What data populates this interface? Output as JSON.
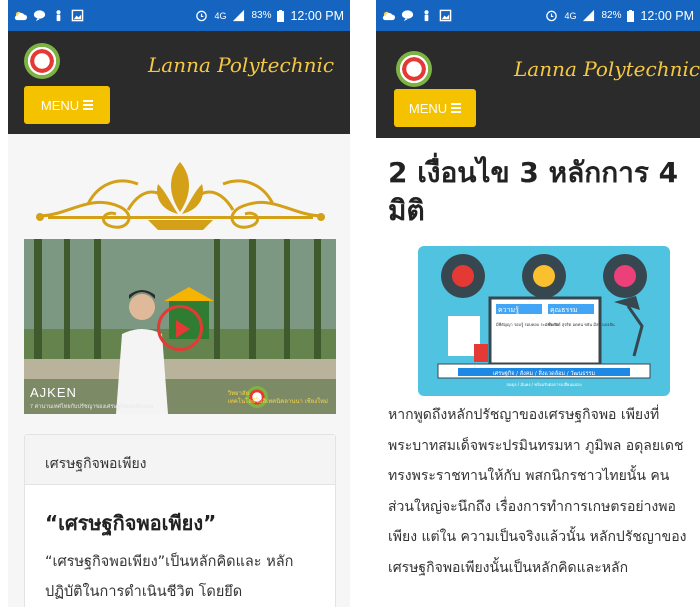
{
  "left_phone": {
    "status": {
      "battery": "83%",
      "time": "12:00 PM",
      "network": "4G"
    },
    "brand": "Lanna Polytechnic",
    "menu_label": "MENU",
    "video": {
      "watermark": "AJKEN",
      "caption": "7 ค่านานเทศไทยกับปรัชญาของเศรษฐกิจพอเพียงคณ",
      "badge_text": "วิทยาลัย\nเทคโนโลยีโปลิเทคนิคลานนา เชียงใหม่"
    },
    "card": {
      "heading": "เศรษฐกิจพอเพียง",
      "title": "“เศรษฐกิจพอเพียง”",
      "text": "“เศรษฐกิจพอเพียง”เป็นหลักคิดและ หลักปฏิบัติในการดำเนินชีวิต โดยยึด"
    }
  },
  "right_phone": {
    "status": {
      "battery": "82%",
      "time": "12:00 PM",
      "network": "4G"
    },
    "brand": "Lanna Polytechnic",
    "menu_label": "MENU",
    "title": "2 เงื่อนไข 3 หลักการ 4 มิติ",
    "illustration": {
      "panel_left_title": "ความรู้",
      "panel_right_title": "คุณธรรม",
      "panel_left_text": "มีพียัญญา รอบรู้ รอบคอบ ระมัดระวัง",
      "panel_right_text": "ซื่อสัตย์ สุจริต อดทน ขยัน มีสติ แบ่งปัน",
      "banner": "เศรษฐกิจ / สังคม / สิ่งแวดล้อม / วัฒนธรรม",
      "banner_sub": "สมดุล / มั่นคง / พร้อมรับต่อการเปลี่ยนแปลง"
    },
    "body": "หากพูดถึงหลักปรัชญาของเศรษฐกิจพอ เพียงที่พระบาทสมเด็จพระปรมินทรมหา ภูมิพล อดุลยเดช ทรงพระราชทานให้กับ พสกนิกรชาวไทยนั้น คนส่วนใหญ่จะนึกถึง เรื่องการทำการเกษตรอย่างพอเพียง แต่ใน ความเป็นจริงแล้วนั้น หลักปรัชญาของ เศรษฐกิจพอเพียงนั้นเป็นหลักคิดและหลัก"
  },
  "colors": {
    "status_bar": "#1565c0",
    "navbar": "#2b2b2b",
    "brand_gold": "#f5c842",
    "menu_button": "#f5c200",
    "play_red": "#e53935"
  },
  "icons": [
    "line-icon",
    "chat-icon",
    "person-icon",
    "gallery-icon",
    "alarm-icon",
    "signal-icon",
    "battery-icon",
    "play-icon",
    "menu-bars-icon"
  ]
}
